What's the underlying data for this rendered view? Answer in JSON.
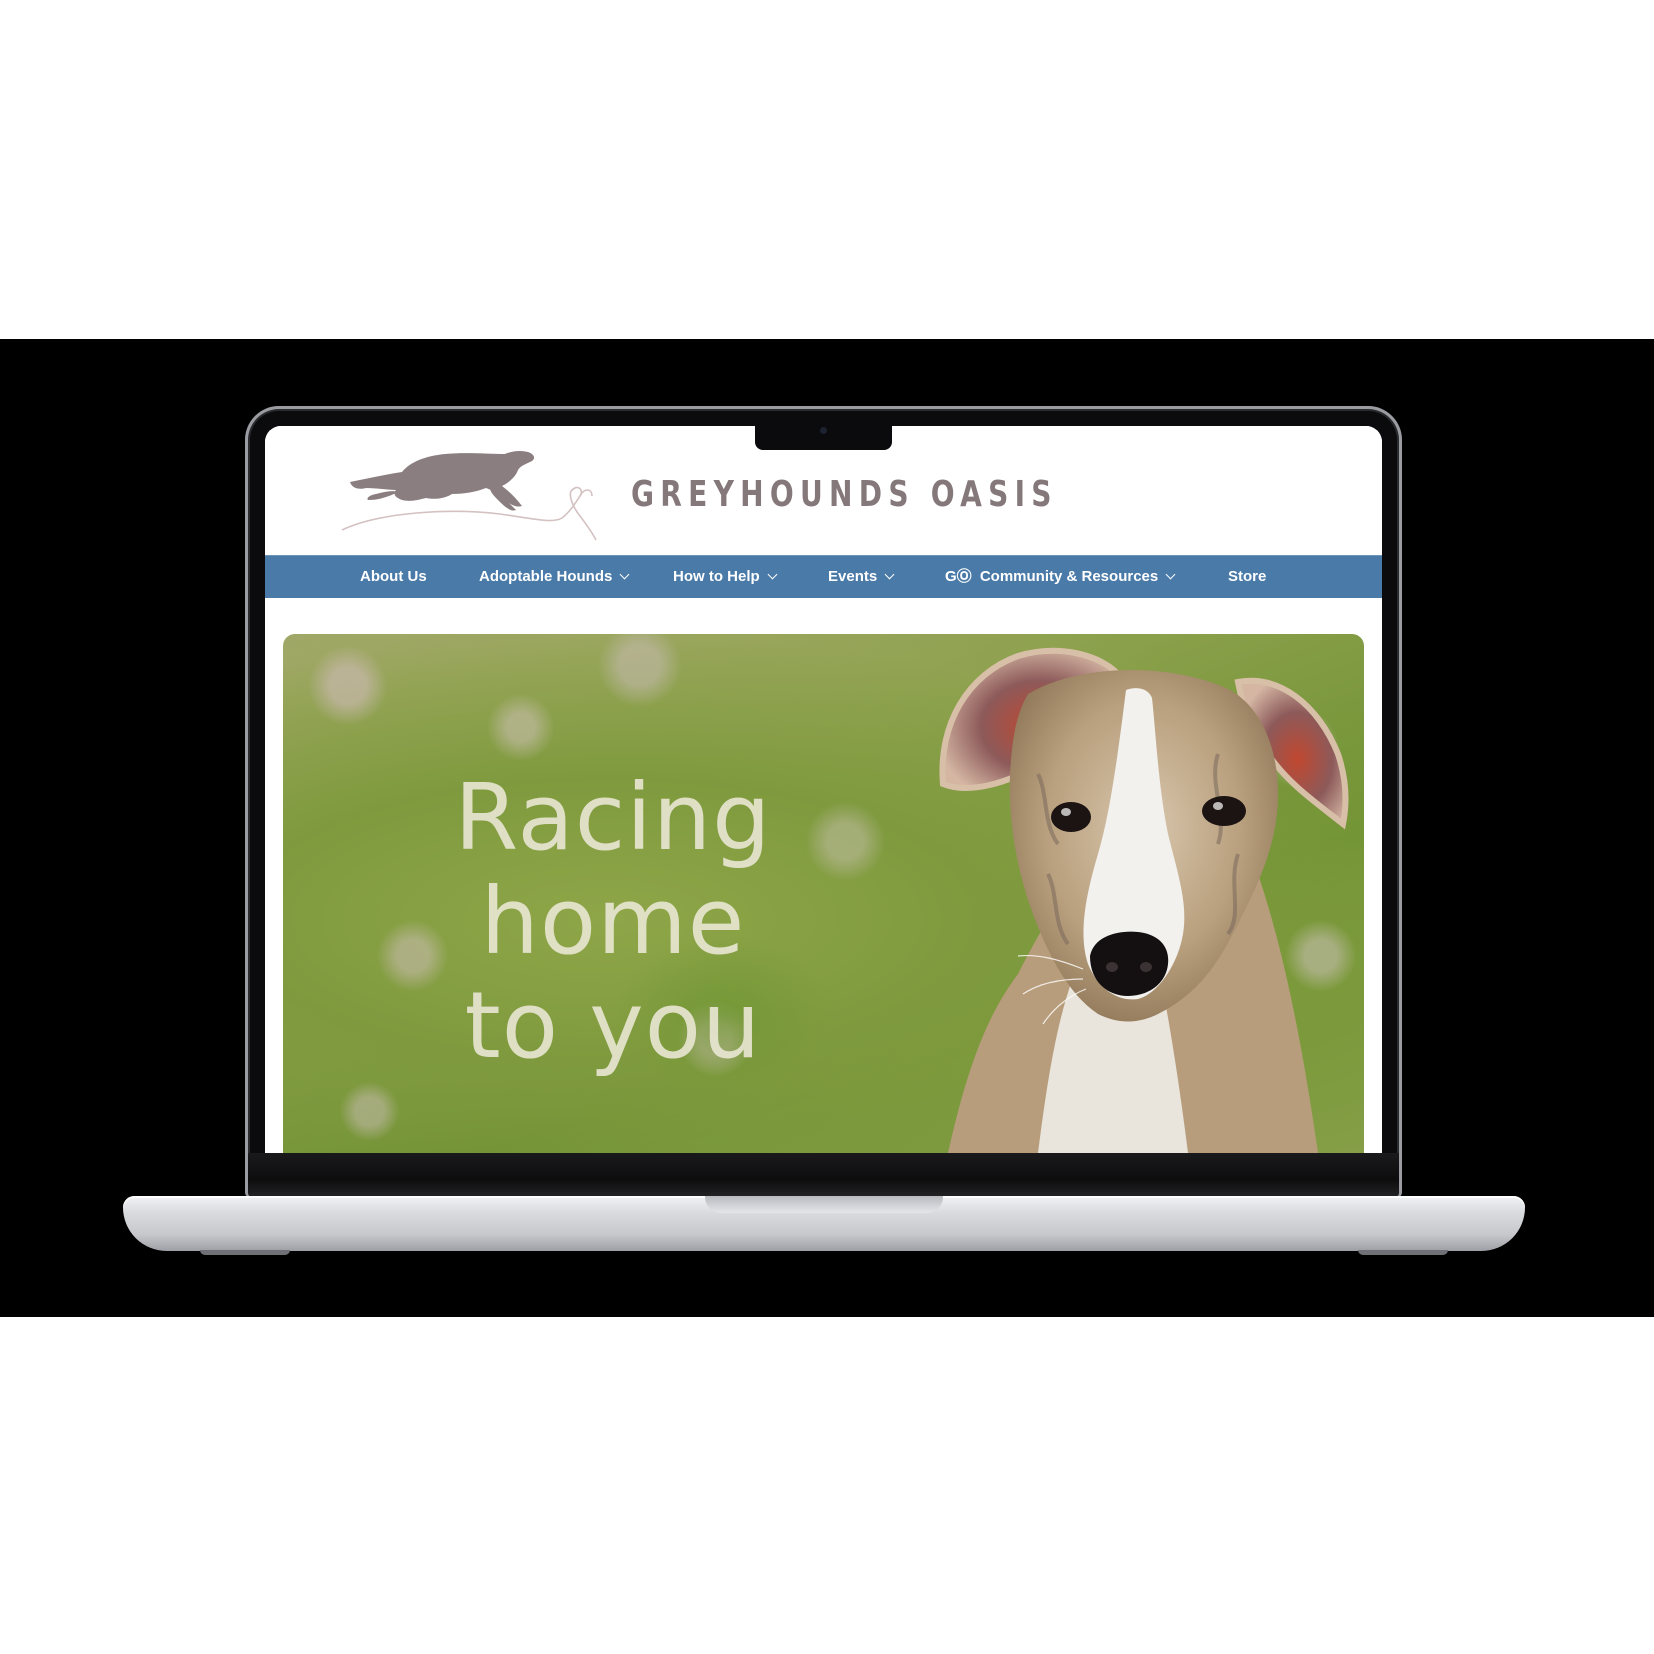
{
  "site": {
    "brand_name": "GREYHOUNDS OASIS"
  },
  "nav": {
    "items": [
      {
        "label": "About Us",
        "has_dropdown": false
      },
      {
        "label": "Adoptable Hounds",
        "has_dropdown": true
      },
      {
        "label": "How to Help",
        "has_dropdown": true
      },
      {
        "label": "Events",
        "has_dropdown": true
      },
      {
        "label": "Community & Resources",
        "prefix_icon_text": "GⓄ",
        "has_dropdown": true
      },
      {
        "label": "Store",
        "has_dropdown": false
      }
    ]
  },
  "hero": {
    "headline_lines": [
      "Racing",
      "home",
      "to you"
    ]
  },
  "colors": {
    "nav_bar": "#4a7aa8",
    "brand_text": "#85787b",
    "page_background_band": "#000000"
  },
  "icons": {
    "logo": "running-greyhound-icon",
    "dropdown": "chevron-down-icon"
  }
}
